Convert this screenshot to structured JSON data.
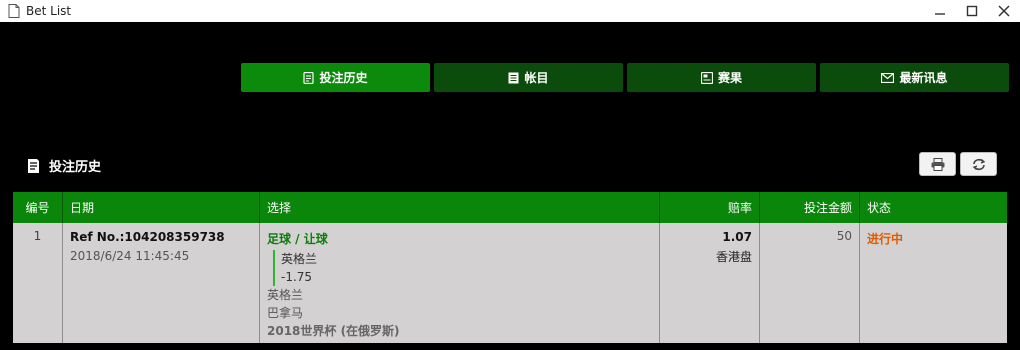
{
  "window": {
    "title": "Bet List"
  },
  "tabs": [
    {
      "label": "投注历史",
      "icon": "receipt-icon",
      "active": true
    },
    {
      "label": "帐目",
      "icon": "ledger-icon",
      "active": false
    },
    {
      "label": "赛果",
      "icon": "results-icon",
      "active": false
    },
    {
      "label": "最新讯息",
      "icon": "mail-icon",
      "active": false
    }
  ],
  "section": {
    "title": "投注历史"
  },
  "table": {
    "headers": [
      "编号",
      "日期",
      "选择",
      "赔率",
      "投注金额",
      "状态"
    ],
    "rows": [
      {
        "num": "1",
        "ref": "Ref No.:104208359738",
        "date": "2018/6/24 11:45:45",
        "sport": "足球 / 让球",
        "pick_team": "英格兰",
        "pick_hdp": "-1.75",
        "home": "英格兰",
        "away": "巴拿马",
        "league": "2018世界杯 (在俄罗斯)",
        "odds": "1.07",
        "odds_type": "香港盘",
        "stake": "50",
        "status": "进行中"
      }
    ]
  },
  "colors": {
    "tab_active": "#0c8a0c",
    "tab_inactive": "#0b4b0b",
    "header_green": "#0a860a",
    "row_bg": "#d3d1d1",
    "status_orange": "#e05a00",
    "sport_green": "#0b7d0b"
  }
}
